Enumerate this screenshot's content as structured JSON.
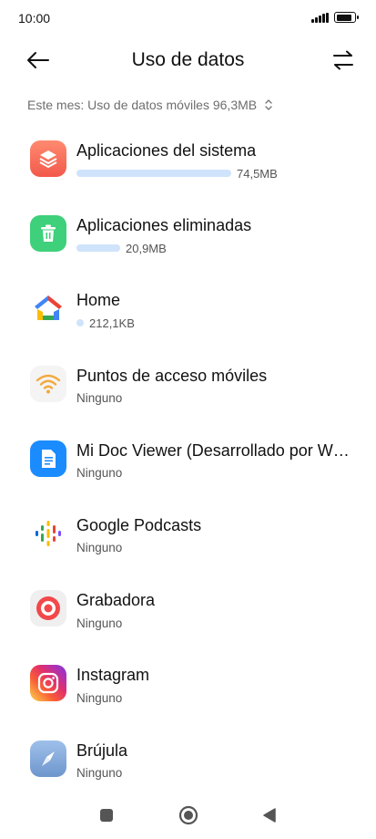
{
  "status_bar": {
    "time": "10:00",
    "battery_level": 0.9
  },
  "header": {
    "title": "Uso de datos"
  },
  "summary": {
    "text": "Este mes: Uso de datos móviles 96,3MB"
  },
  "apps": [
    {
      "name": "Aplicaciones del sistema",
      "usage": "74,5MB",
      "usage_mb": 74.5,
      "icon": "layers-icon"
    },
    {
      "name": "Aplicaciones eliminadas",
      "usage": "20,9MB",
      "usage_mb": 20.9,
      "icon": "trash-icon"
    },
    {
      "name": "Home",
      "usage": "212,1KB",
      "usage_mb": 0.21,
      "icon": "google-home-icon"
    },
    {
      "name": "Puntos de acceso móviles",
      "usage": "Ninguno",
      "icon": "wifi-hotspot-icon"
    },
    {
      "name": "Mi Doc Viewer (Desarrollado por WPS Office)",
      "usage": "Ninguno",
      "icon": "document-icon"
    },
    {
      "name": "Google Podcasts",
      "usage": "Ninguno",
      "icon": "podcasts-icon"
    },
    {
      "name": "Grabadora",
      "usage": "Ninguno",
      "icon": "recorder-icon"
    },
    {
      "name": "Instagram",
      "usage": "Ninguno",
      "icon": "instagram-icon"
    },
    {
      "name": "Brújula",
      "usage": "Ninguno",
      "icon": "compass-icon"
    }
  ],
  "colors": {
    "usage_bar": "#cfe3fb",
    "accent_blue": "#1a8cff",
    "text": "#111111",
    "subtext": "#555555"
  }
}
